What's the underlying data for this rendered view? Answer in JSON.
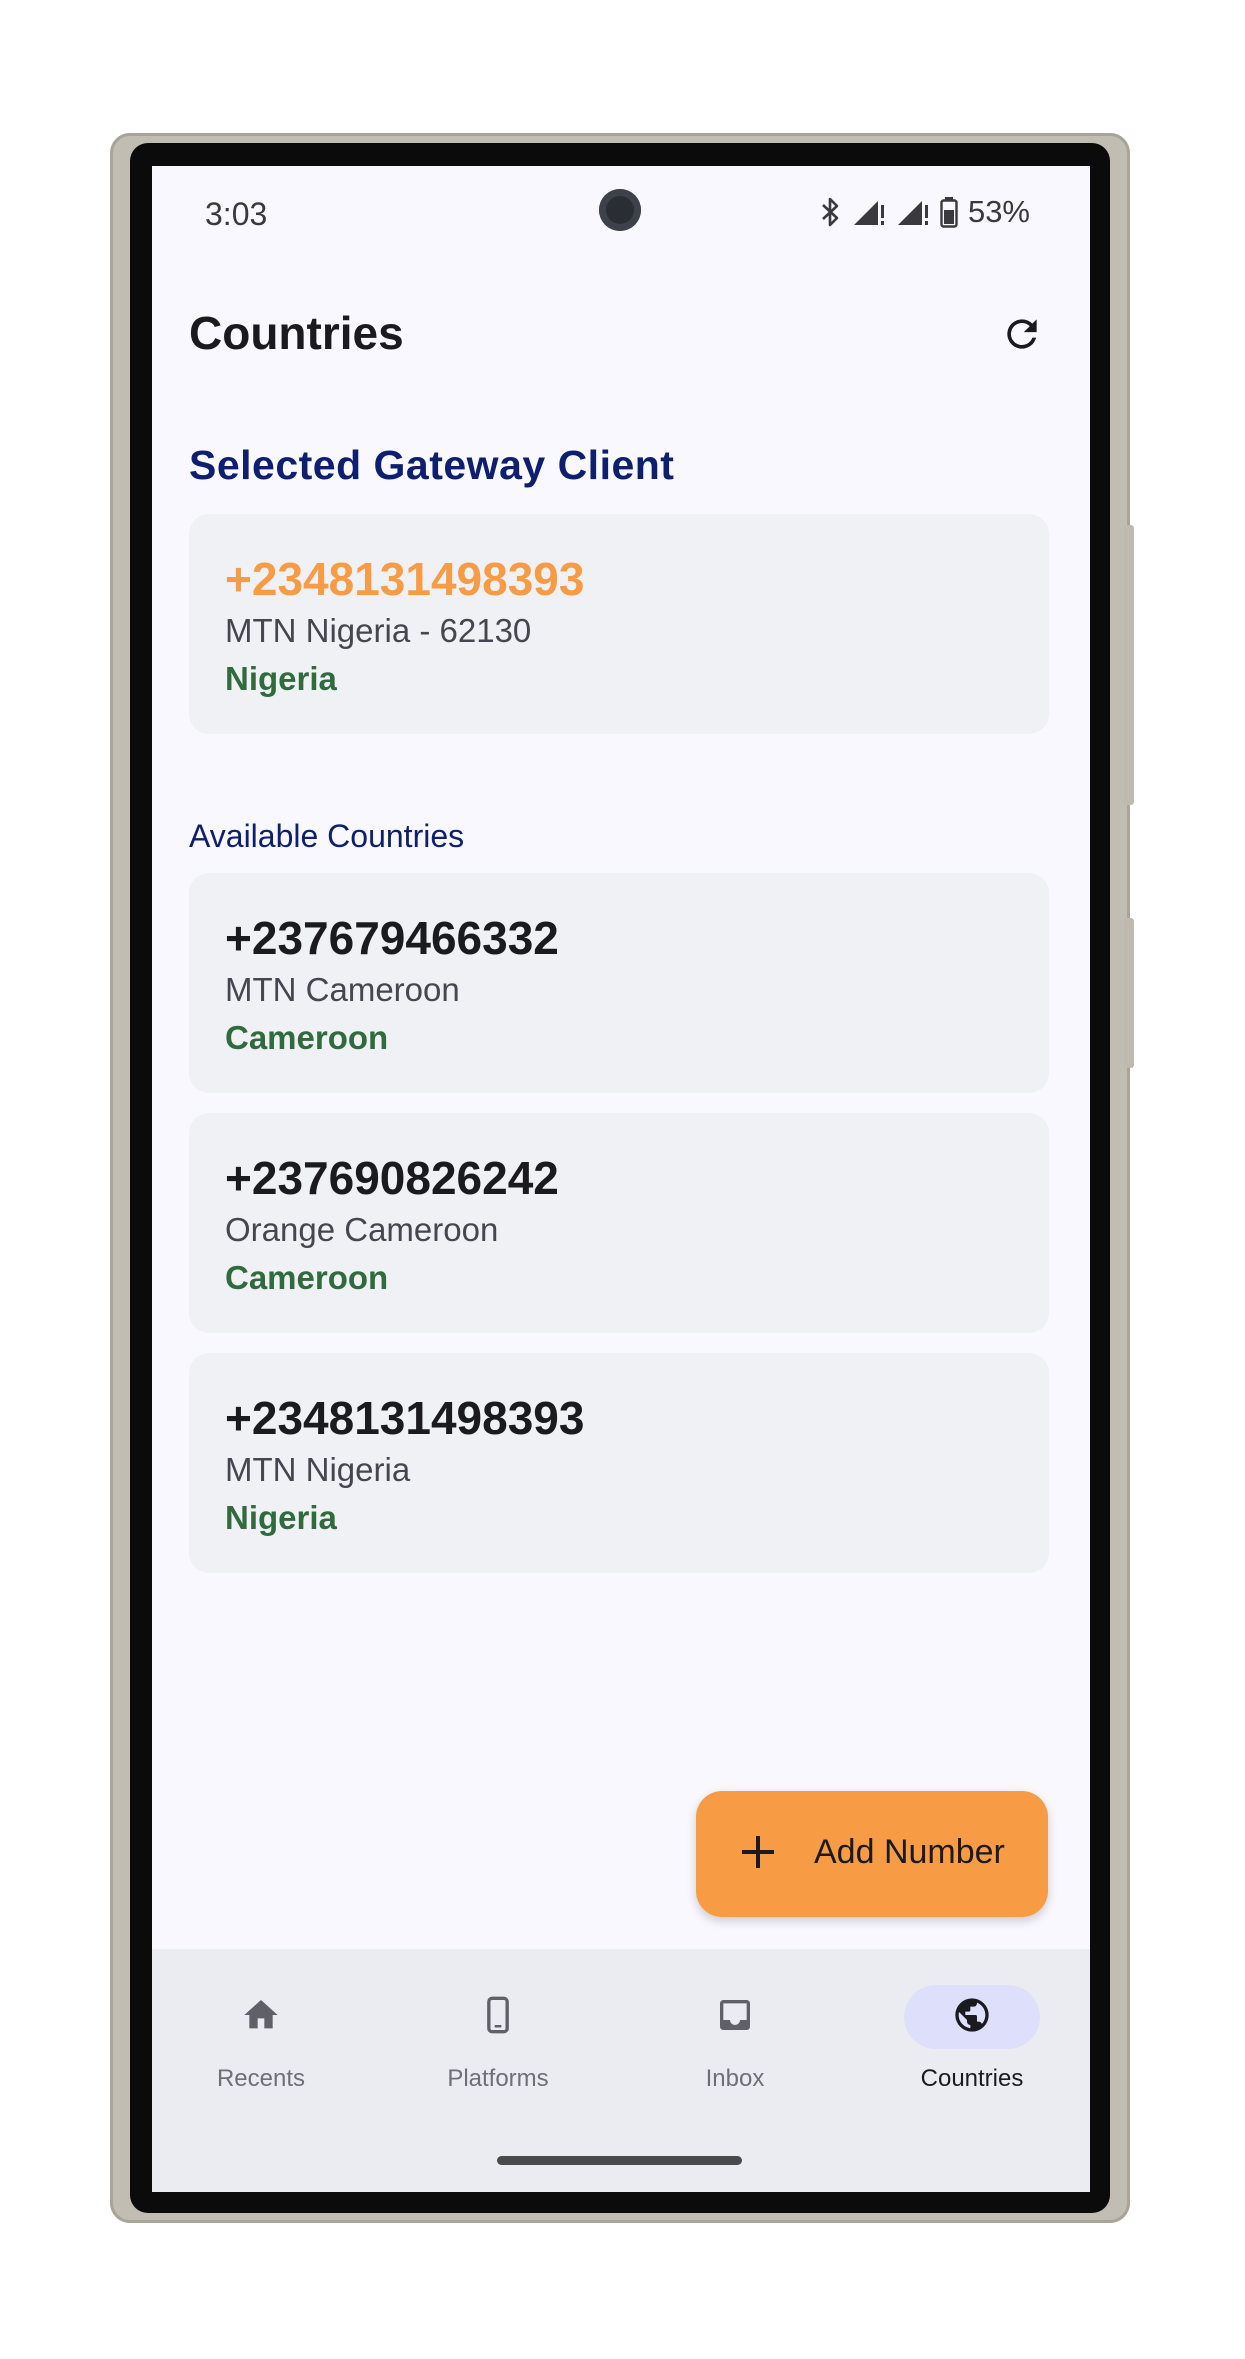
{
  "status_bar": {
    "time": "3:03",
    "battery": "53%",
    "icons": [
      "bluetooth-icon",
      "signal-icon",
      "signal-icon",
      "battery-icon"
    ]
  },
  "header": {
    "title": "Countries",
    "refresh_icon": "refresh-icon"
  },
  "selected": {
    "section_title": "Selected Gateway Client",
    "number": "+2348131498393",
    "operator": "MTN Nigeria - 62130",
    "country": "Nigeria"
  },
  "available": {
    "section_title": "Available Countries",
    "items": [
      {
        "number": "+237679466332",
        "operator": "MTN Cameroon",
        "country": "Cameroon"
      },
      {
        "number": "+237690826242",
        "operator": "Orange Cameroon",
        "country": "Cameroon"
      },
      {
        "number": "+2348131498393",
        "operator": "MTN Nigeria",
        "country": "Nigeria"
      }
    ]
  },
  "fab": {
    "label": "Add Number",
    "icon": "plus-icon"
  },
  "nav": {
    "items": [
      {
        "label": "Recents",
        "icon": "home-icon",
        "active": false
      },
      {
        "label": "Platforms",
        "icon": "phone-icon",
        "active": false
      },
      {
        "label": "Inbox",
        "icon": "inbox-icon",
        "active": false
      },
      {
        "label": "Countries",
        "icon": "globe-icon",
        "active": true
      }
    ]
  },
  "colors": {
    "accent": "#f79c45",
    "title_navy": "#0d1f6e",
    "country_green": "#2f6b3d",
    "nav_active_pill": "#dee0fb"
  }
}
